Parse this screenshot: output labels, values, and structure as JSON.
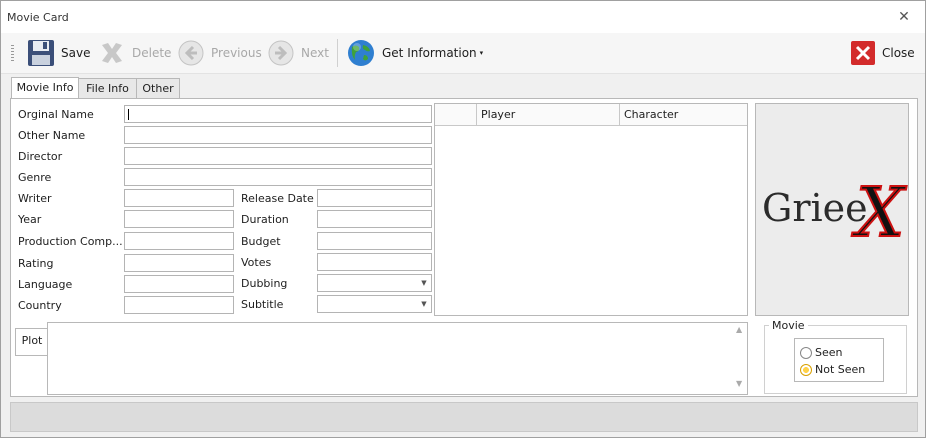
{
  "window": {
    "title": "Movie Card",
    "close_glyph": "✕"
  },
  "toolbar": {
    "save": "Save",
    "delete": "Delete",
    "previous": "Previous",
    "next": "Next",
    "get_information": "Get Information",
    "close": "Close"
  },
  "tabs": [
    {
      "label": "Movie Info",
      "active": true
    },
    {
      "label": "File Info",
      "active": false
    },
    {
      "label": "Other",
      "active": false
    }
  ],
  "form": {
    "original_name": "Orginal Name",
    "other_name": "Other Name",
    "director": "Director",
    "genre": "Genre",
    "writer": "Writer",
    "year": "Year",
    "production_company": "Production Comp...",
    "rating": "Rating",
    "language": "Language",
    "country": "Country",
    "release_date": "Release Date",
    "duration": "Duration",
    "budget": "Budget",
    "votes": "Votes",
    "dubbing": "Dubbing",
    "subtitle": "Subtitle"
  },
  "cast_grid": {
    "columns": [
      "",
      "Player",
      "Character"
    ]
  },
  "logo": {
    "text": "Griee",
    "x": "X"
  },
  "plot": {
    "label": "Plot"
  },
  "movie_group": {
    "title": "Movie",
    "options": [
      "Seen",
      "Not Seen"
    ],
    "selected": "Not Seen"
  }
}
